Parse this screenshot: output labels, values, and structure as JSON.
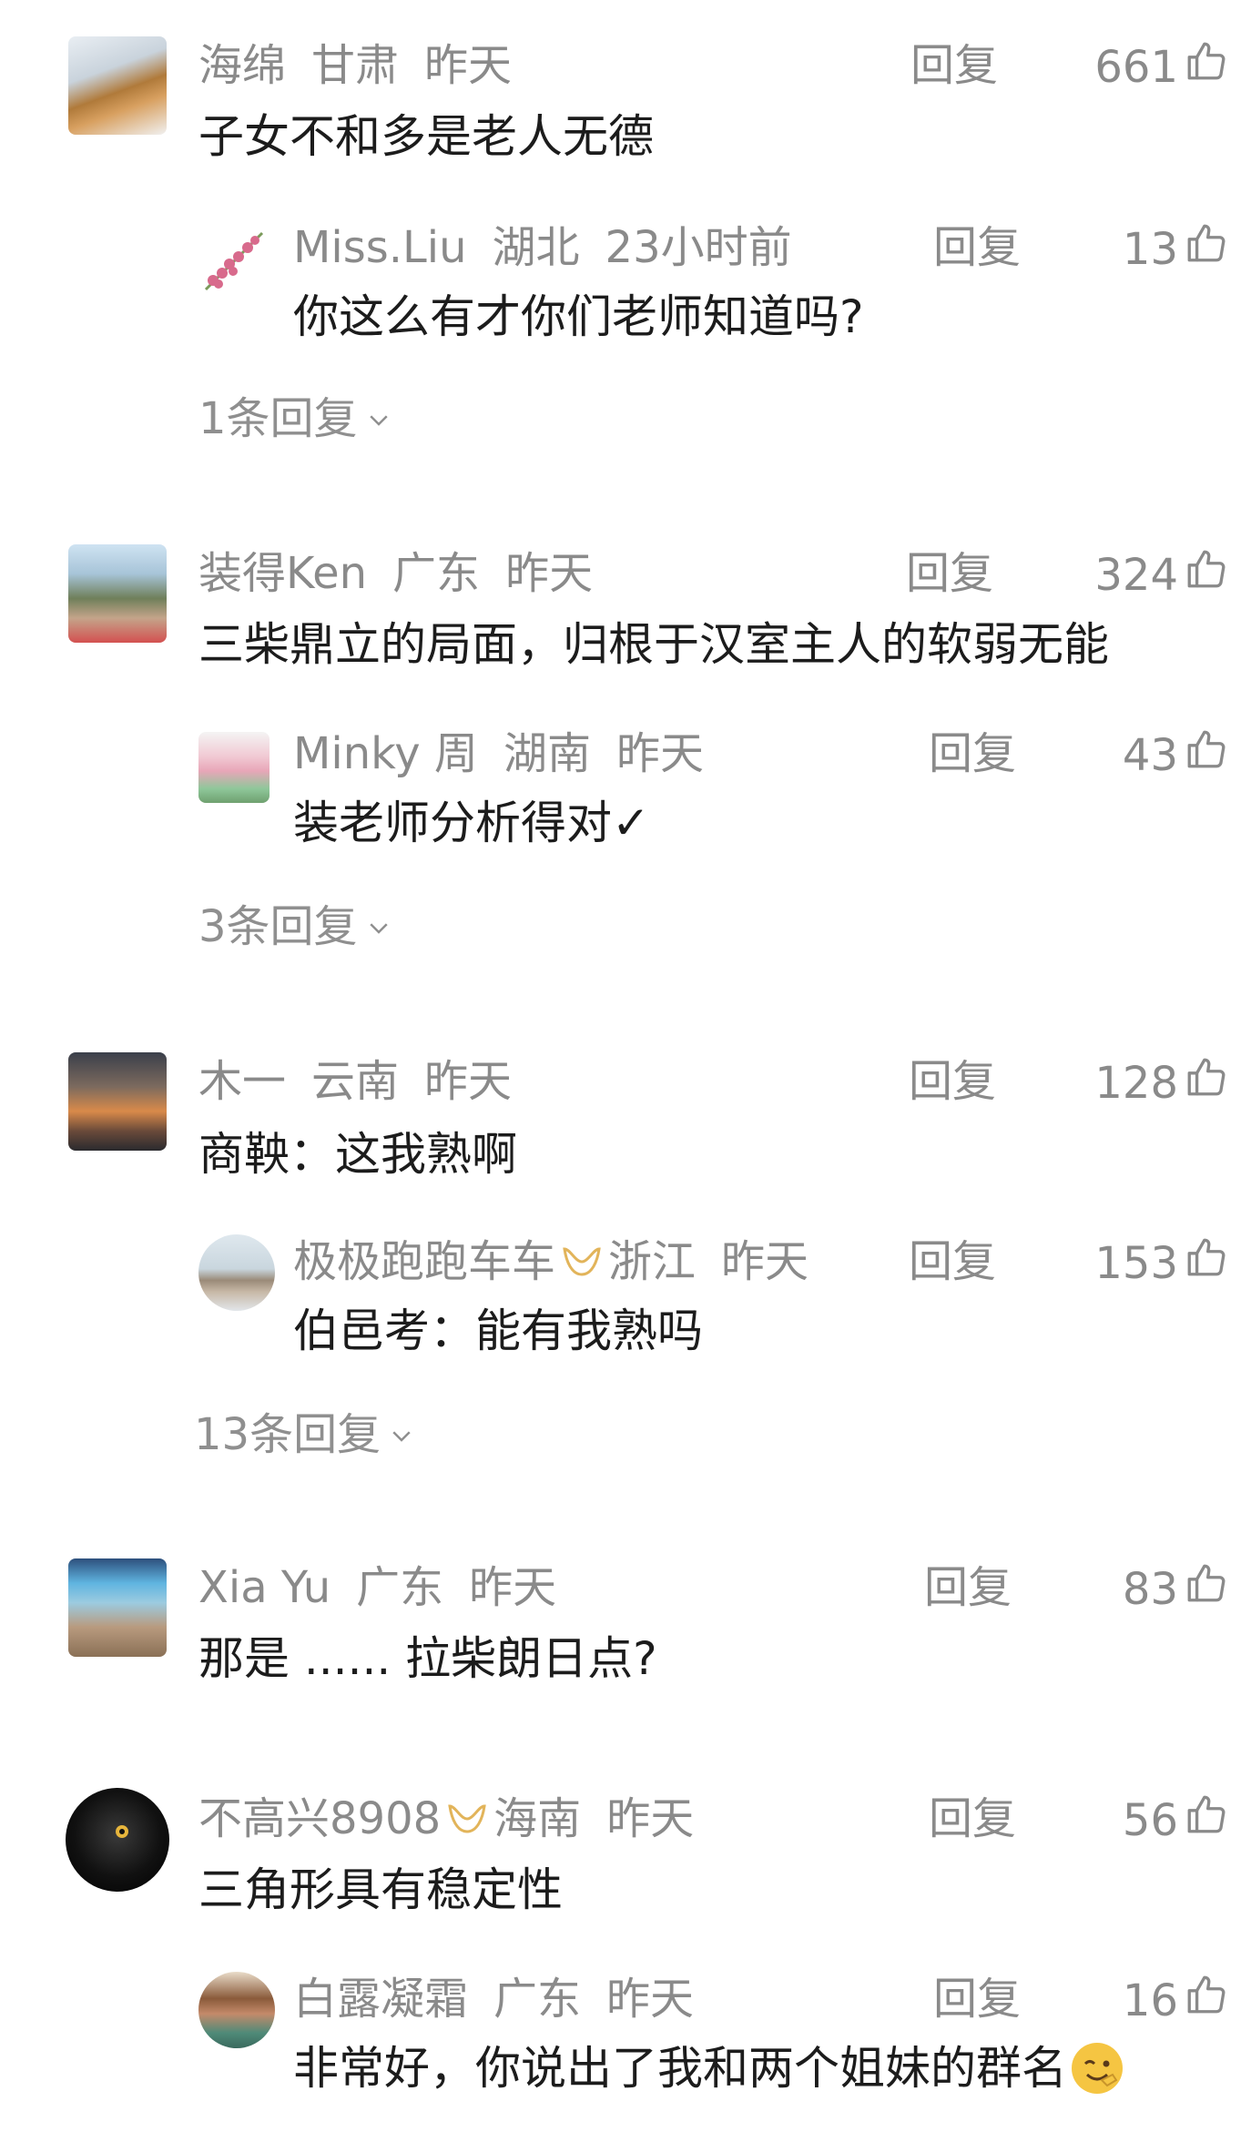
{
  "reply_label": "回复",
  "comments": [
    {
      "user": "海绵",
      "region": "甘肃",
      "time": "昨天",
      "likes": "661",
      "text": "子女不和多是老人无德",
      "sub": {
        "user": "Miss.Liu",
        "region": "湖北",
        "time": "23小时前",
        "likes": "13",
        "text": "你这么有才你们老师知道吗?"
      },
      "more": "1条回复"
    },
    {
      "user": "装得Ken",
      "region": "广东",
      "time": "昨天",
      "likes": "324",
      "text": "三柴鼎立的局面，归根于汉室主人的软弱无能",
      "sub": {
        "user": "Minky 周",
        "region": "湖南",
        "time": "昨天",
        "likes": "43",
        "text": "装老师分析得对✓"
      },
      "more": "3条回复"
    },
    {
      "user": "木一",
      "region": "云南",
      "time": "昨天",
      "likes": "128",
      "text": "商鞅：这我熟啊",
      "sub": {
        "user": "极极跑跑车车",
        "region": "浙江",
        "time": "昨天",
        "likes": "153",
        "text": "伯邑考：能有我熟吗"
      },
      "more": "13条回复"
    },
    {
      "user": "Xia Yu",
      "region": "广东",
      "time": "昨天",
      "likes": "83",
      "text": "那是 ...... 拉柴朗日点?"
    },
    {
      "user": "不高兴8908",
      "region": "海南",
      "time": "昨天",
      "likes": "56",
      "text": "三角形具有稳定性",
      "sub": {
        "user": "白露凝霜",
        "region": "广东",
        "time": "昨天",
        "likes": "16",
        "text": "非常好，你说出了我和两个姐妹的群名"
      }
    }
  ],
  "colors": {
    "meta": "#8a8a8a",
    "text": "#1c1c1c",
    "badge": "#e2b45a"
  }
}
